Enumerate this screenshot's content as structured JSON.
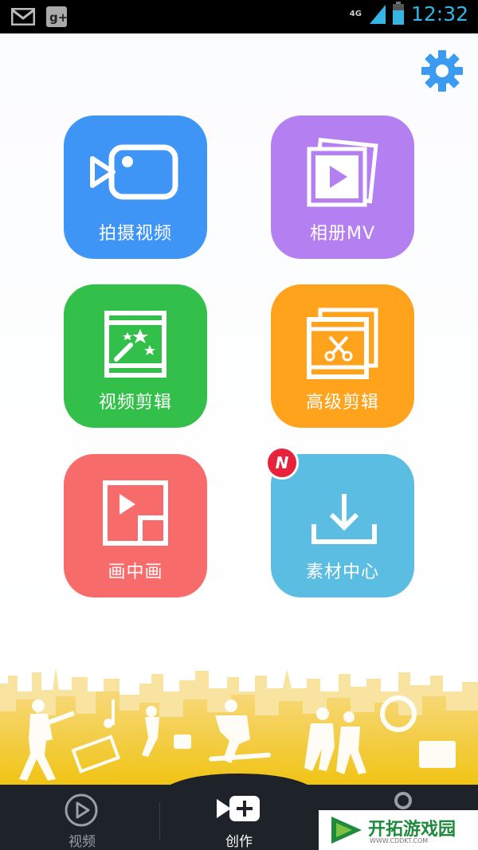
{
  "status_bar": {
    "network": "4G",
    "time": "12:32",
    "icons": [
      "gmail-icon",
      "google-plus-icon",
      "signal-icon",
      "battery-icon"
    ]
  },
  "settings": {
    "icon": "gear-icon",
    "color": "#3a9bf0"
  },
  "tiles": [
    {
      "label": "拍摄视频",
      "icon": "video-camera-icon",
      "color": "#3f95f6"
    },
    {
      "label": "相册MV",
      "icon": "photo-album-play-icon",
      "color": "#b47ff1"
    },
    {
      "label": "视频剪辑",
      "icon": "magic-film-icon",
      "color": "#33c04a"
    },
    {
      "label": "高级剪辑",
      "icon": "scissors-film-icon",
      "color": "#ffa21c"
    },
    {
      "label": "画中画",
      "icon": "picture-in-picture-icon",
      "color": "#f76b6b"
    },
    {
      "label": "素材中心",
      "icon": "download-icon",
      "color": "#5cbde3",
      "badge": "N"
    }
  ],
  "bottom_nav": {
    "items": [
      {
        "label": "视频",
        "icon": "play-circle-icon",
        "active": false
      },
      {
        "label": "创作",
        "icon": "create-plus-icon",
        "active": true
      },
      {
        "label": "",
        "icon": "profile-icon",
        "active": false
      }
    ]
  },
  "watermark": {
    "title": "开拓游戏园",
    "url": "WWW.CDDKT.COM"
  }
}
